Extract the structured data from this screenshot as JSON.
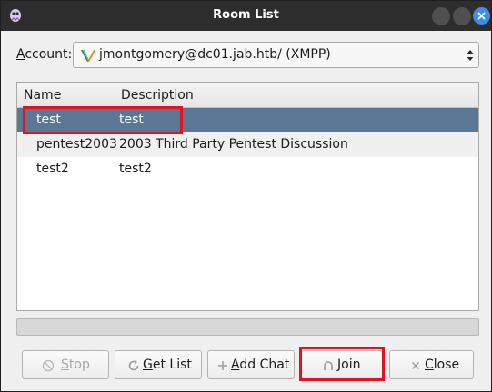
{
  "window": {
    "title": "Room List"
  },
  "account": {
    "label_prefix": "",
    "label_underlined": "A",
    "label_suffix": "ccount:",
    "selected": "jmontgomery@dc01.jab.htb/ (XMPP)",
    "protocol_icon": "xmpp-icon"
  },
  "table": {
    "columns": [
      "Name",
      "Description"
    ],
    "rows": [
      {
        "name": "test",
        "description": "test",
        "selected": true
      },
      {
        "name": "pentest2003",
        "description": "2003 Third Party Pentest Discussion",
        "selected": false
      },
      {
        "name": "test2",
        "description": "test2",
        "selected": false
      }
    ]
  },
  "buttons": {
    "stop": {
      "underlined": "S",
      "rest": "top",
      "icon": "stop-icon",
      "enabled": false
    },
    "get_list": {
      "underlined": "G",
      "rest": "et List",
      "icon": "refresh-icon",
      "enabled": true
    },
    "add_chat": {
      "underlined": "A",
      "rest": "dd Chat",
      "icon": "plus-icon",
      "enabled": true
    },
    "join": {
      "underlined": "J",
      "rest": "oin",
      "icon": "join-icon",
      "enabled": true
    },
    "close": {
      "underlined": "C",
      "rest": "lose",
      "icon": "close-icon",
      "enabled": true
    }
  },
  "colors": {
    "selection": "#5a7896",
    "highlight_box": "#e0141e",
    "titlebar": "#2d2d2d",
    "close_button": "#3d8ee6"
  }
}
